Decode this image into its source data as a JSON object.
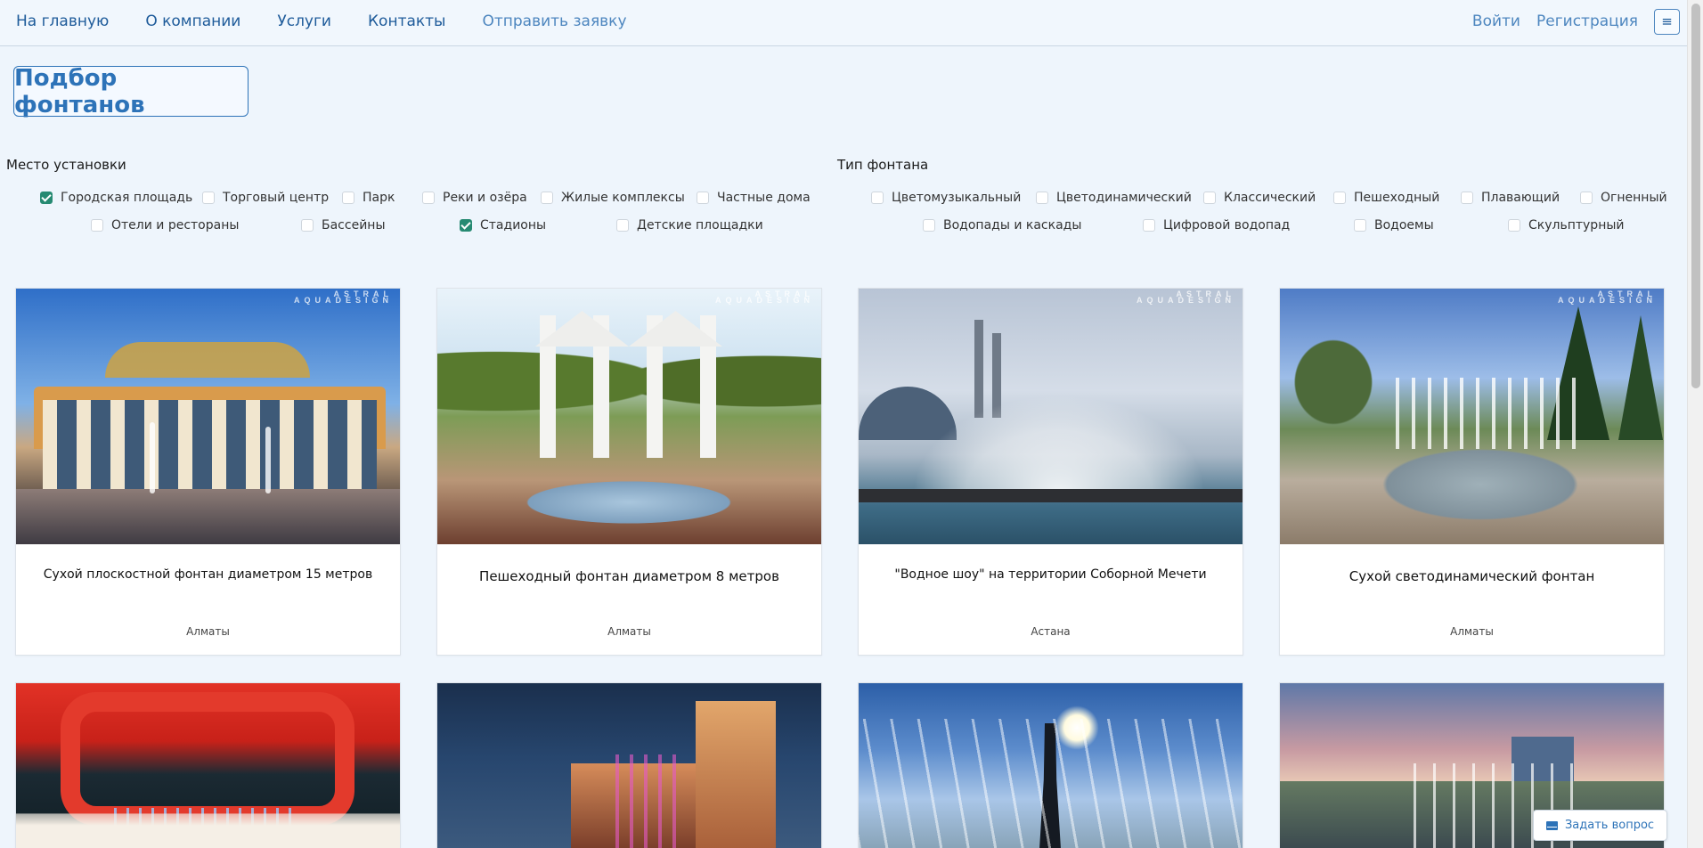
{
  "nav": {
    "home": "На главную",
    "about": "О компании",
    "services": "Услуги",
    "contacts": "Контакты",
    "request": "Отправить заявку",
    "login": "Войти",
    "register": "Регистрация",
    "menu_icon": "≡"
  },
  "page": {
    "title": "Подбор фонтанов"
  },
  "filters": {
    "location": {
      "heading": "Место установки",
      "options": [
        {
          "label": "Городская площадь",
          "checked": true
        },
        {
          "label": "Торговый центр",
          "checked": false
        },
        {
          "label": "Парк",
          "checked": false
        },
        {
          "label": "Реки и озёра",
          "checked": false
        },
        {
          "label": "Жилые комплексы",
          "checked": false
        },
        {
          "label": "Частные дома",
          "checked": false
        },
        {
          "label": "Отели и рестораны",
          "checked": false
        },
        {
          "label": "Бассейны",
          "checked": false
        },
        {
          "label": "Стадионы",
          "checked": true
        },
        {
          "label": "Детские площадки",
          "checked": false
        }
      ]
    },
    "type": {
      "heading": "Тип фонтана",
      "options": [
        {
          "label": "Цветомузыкальный",
          "checked": false
        },
        {
          "label": "Цветодинамический",
          "checked": false
        },
        {
          "label": "Классический",
          "checked": false
        },
        {
          "label": "Пешеходный",
          "checked": false
        },
        {
          "label": "Плавающий",
          "checked": false
        },
        {
          "label": "Огненный",
          "checked": false
        },
        {
          "label": "Водопады и каскады",
          "checked": false
        },
        {
          "label": "Цифровой водопад",
          "checked": false
        },
        {
          "label": "Водоемы",
          "checked": false
        },
        {
          "label": "Скульптурный",
          "checked": false
        }
      ]
    }
  },
  "watermark": {
    "brand": "ASTRAL",
    "sub": "AQUADESIGN"
  },
  "cards": [
    {
      "title": "Сухой плоскостной фонтан диаметром 15 метров",
      "city": "Алматы",
      "image": "park-arch-fountain"
    },
    {
      "title": "Пешеходный фонтан диаметром 8 метров",
      "city": "Алматы",
      "image": "white-arches-fountain"
    },
    {
      "title": "\"Водное шоу\" на территории Соборной Мечети",
      "city": "Астана",
      "image": "mosque-fountain"
    },
    {
      "title": "Сухой светодинамический фонтан",
      "city": "Алматы",
      "image": "plaza-dry-fountain"
    },
    {
      "image": "mosfilm-fountain"
    },
    {
      "image": "night-tower-fountain"
    },
    {
      "image": "sculpture-fountain"
    },
    {
      "image": "sunset-fountain"
    }
  ],
  "ask_button": {
    "label": "Задать вопрос",
    "icon": "envelope-icon"
  }
}
